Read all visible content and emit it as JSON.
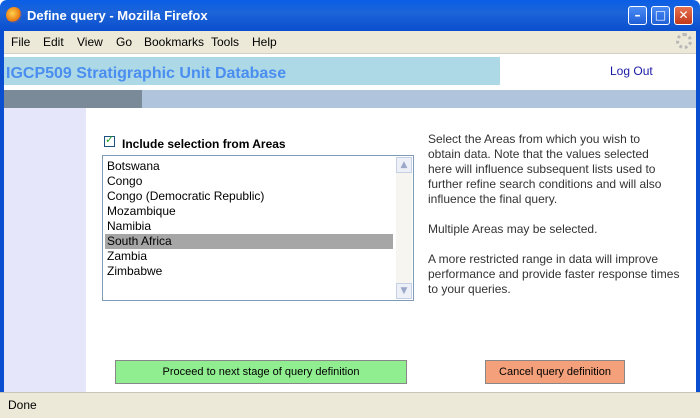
{
  "window": {
    "title": "Define query - Mozilla Firefox",
    "minimize_glyph": "–",
    "maximize_glyph": "□",
    "close_glyph": "✕"
  },
  "menu": [
    "File",
    "Edit",
    "View",
    "Go",
    "Bookmarks",
    "Tools",
    "Help"
  ],
  "header": {
    "site_title": "IGCP509 Stratigraphic Unit Database",
    "logout": "Log Out"
  },
  "progress": {
    "fraction": 0.2
  },
  "form": {
    "checkbox_label": "Include selection from Areas",
    "checkbox_checked": true,
    "areas": [
      "Botswana",
      "Congo",
      "Congo (Democratic Republic)",
      "Mozambique",
      "Namibia",
      "South Africa",
      "Zambia",
      "Zimbabwe"
    ],
    "selected_area": "South Africa"
  },
  "help": {
    "para1": [
      "Select the Areas from which you wish to",
      "obtain data. Note that the values selected",
      "here will influence subsequent lists used to",
      "further refine search conditions and will also",
      "influence the final query."
    ],
    "para2": [
      "Multiple Areas may be selected."
    ],
    "para3": [
      "A more restricted range in data will improve",
      "performance and provide faster response times",
      "to your queries."
    ]
  },
  "buttons": {
    "proceed": "Proceed to next stage of query definition",
    "cancel": "Cancel query definition"
  },
  "status": {
    "text": "Done"
  },
  "colors": {
    "proceed_bg": "#90ee90",
    "cancel_bg": "#f4a07a",
    "header_band": "#add8e6",
    "progress_track": "#b0c4de"
  }
}
